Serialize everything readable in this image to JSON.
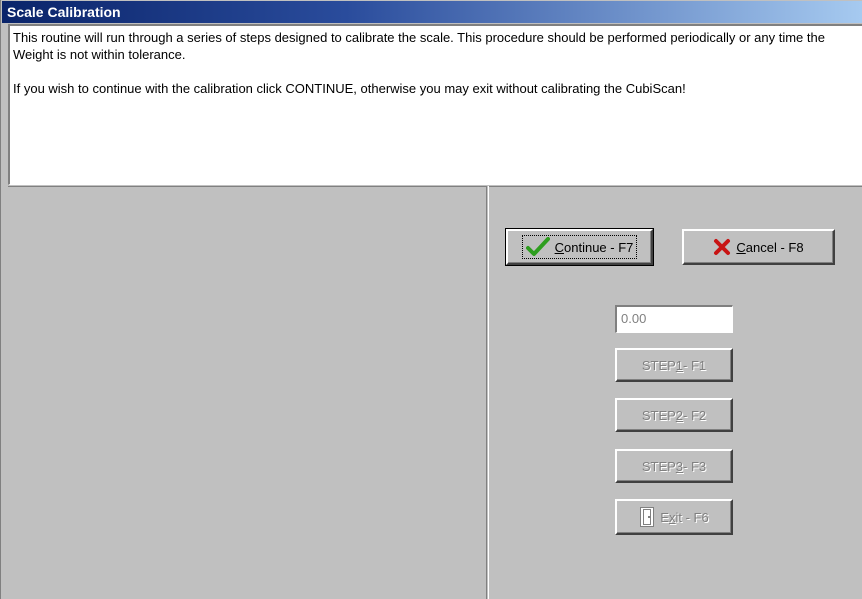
{
  "window": {
    "title": "Scale Calibration"
  },
  "message": {
    "paragraph1": "This routine will run through a series of steps designed to calibrate the scale. This procedure should be performed periodically or any time the Weight is not within tolerance.",
    "paragraph2": "If you wish to continue with the calibration click CONTINUE, otherwise you may exit without calibrating the CubiScan!"
  },
  "buttons": {
    "continue": {
      "mnemonic": "C",
      "rest": "ontinue - F7",
      "icon": "checkmark-icon",
      "icon_color": "#2e9e1f"
    },
    "cancel": {
      "mnemonic": "C",
      "rest": "ancel - F8",
      "icon": "x-icon",
      "icon_color": "#c81414"
    },
    "step1": {
      "prefix": "STEP ",
      "mnemonic": "1",
      "rest": " - F1",
      "enabled": false
    },
    "step2": {
      "prefix": "STEP ",
      "mnemonic": "2",
      "rest": " - F2",
      "enabled": false
    },
    "step3": {
      "prefix": "STEP ",
      "mnemonic": "3",
      "rest": " - F3",
      "enabled": false
    },
    "exit": {
      "prefix": "E",
      "mnemonic": "x",
      "rest": "it - F6",
      "icon": "door-icon",
      "enabled": false
    }
  },
  "weight": {
    "value": "0.00"
  },
  "colors": {
    "titlebar": "#0a246a",
    "face": "#c0c0c0"
  }
}
